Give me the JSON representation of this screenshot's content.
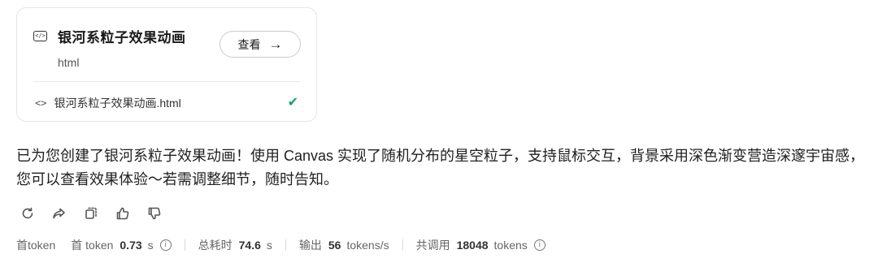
{
  "artifact_card": {
    "title": "银河系粒子效果动画",
    "type": "html",
    "view_label": "查看",
    "view_arrow": "→",
    "file_name": "银河系粒子效果动画.html",
    "code_icon_glyph": "</>",
    "file_icon_glyph": "<>",
    "status": "✔",
    "status_color": "#1aa260",
    "icons": [
      "code-icon",
      "arrow-right-icon",
      "file-code-icon",
      "check-icon"
    ]
  },
  "message": {
    "text": "已为您创建了银河系粒子效果动画！使用 Canvas 实现了随机分布的星空粒子，支持鼠标交互，背景采用深色渐变营造深邃宇宙感，您可以查看效果体验～若需调整细节，随时告知。"
  },
  "actions": [
    "regenerate-icon",
    "share-icon",
    "copy-icon",
    "thumbs-up-icon",
    "thumbs-down-icon"
  ],
  "stats": {
    "first_token_prefix": "首token",
    "first_token_label": "首 token",
    "first_token_value": "0.73",
    "first_token_unit": "s",
    "total_time_label": "总耗时",
    "total_time_value": "74.6",
    "total_time_unit": "s",
    "output_label": "输出",
    "output_value": "56",
    "output_unit": "tokens/s",
    "total_calls_label": "共调用",
    "total_calls_value": "18048",
    "total_calls_unit": "tokens",
    "info_glyph": "i"
  }
}
